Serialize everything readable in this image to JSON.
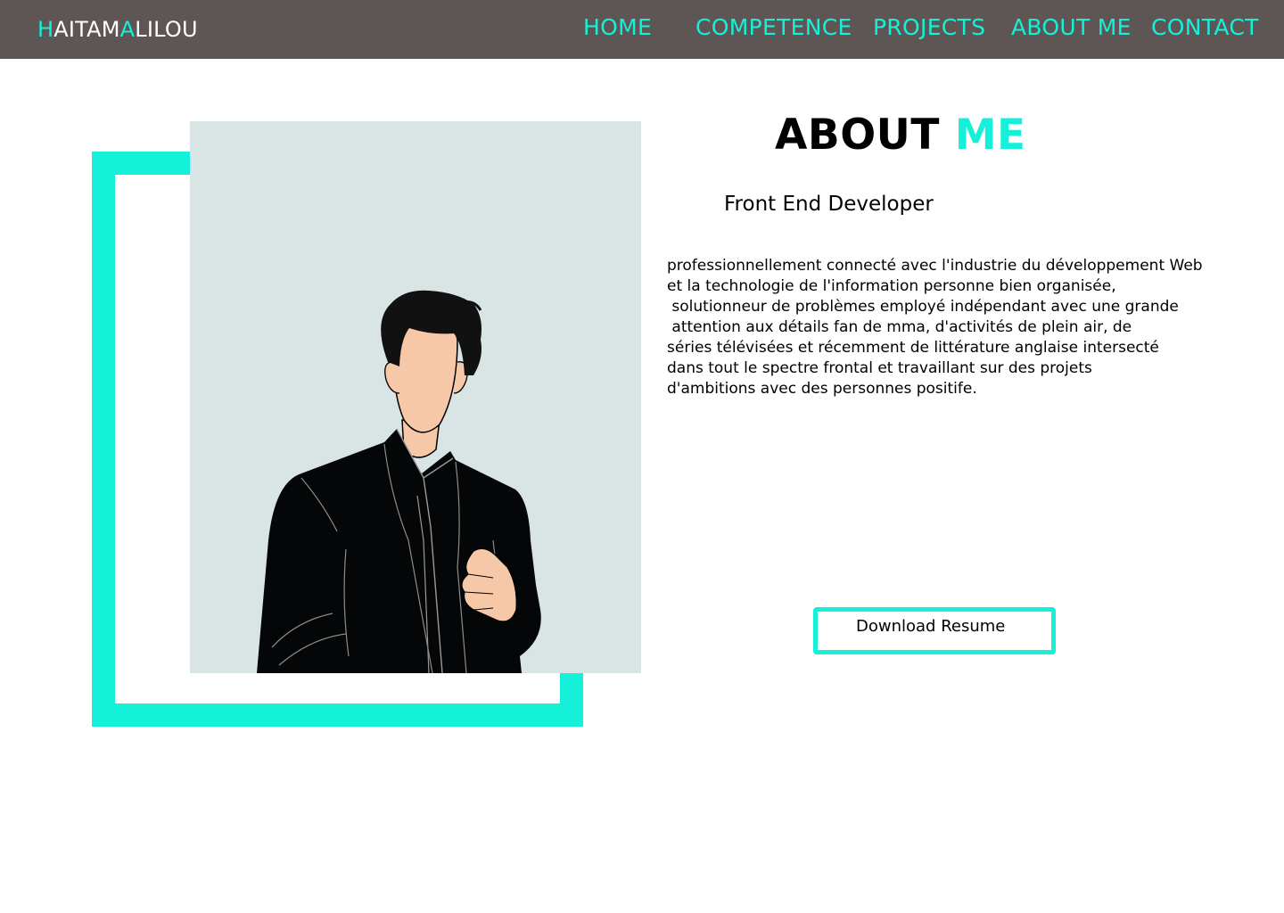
{
  "header": {
    "logo": {
      "part1_accent": "H",
      "part1": "AITAM",
      "part2_accent": "A",
      "part2": "LILOU"
    },
    "nav": [
      {
        "label": "HOME"
      },
      {
        "label": "COMPETENCE"
      },
      {
        "label": "PROJECTS"
      },
      {
        "label": "ABOUT ME"
      },
      {
        "label": "CONTACT"
      }
    ]
  },
  "about": {
    "title_main": "ABOUT",
    "title_accent": "ME",
    "role": "Front End Developer",
    "bio_lines": [
      "professionnellement connecté avec l'industrie du développement Web",
      "et la technologie de l'information personne bien organisée,",
      " solutionneur de problèmes employé indépendant avec une grande",
      " attention aux détails fan de mma, d'activités de plein air, de",
      "séries télévisées et récemment de littérature anglaise intersecté",
      "dans tout le spectre frontal et travaillant sur des projets",
      "d'ambitions avec des personnes positife."
    ],
    "resume_button": "Download Resume"
  },
  "colors": {
    "accent": "#15f1d9",
    "navbar_bg": "#5e5654",
    "photo_bg": "#d8e5e4"
  },
  "icons": {
    "portrait": "person-illustration"
  }
}
